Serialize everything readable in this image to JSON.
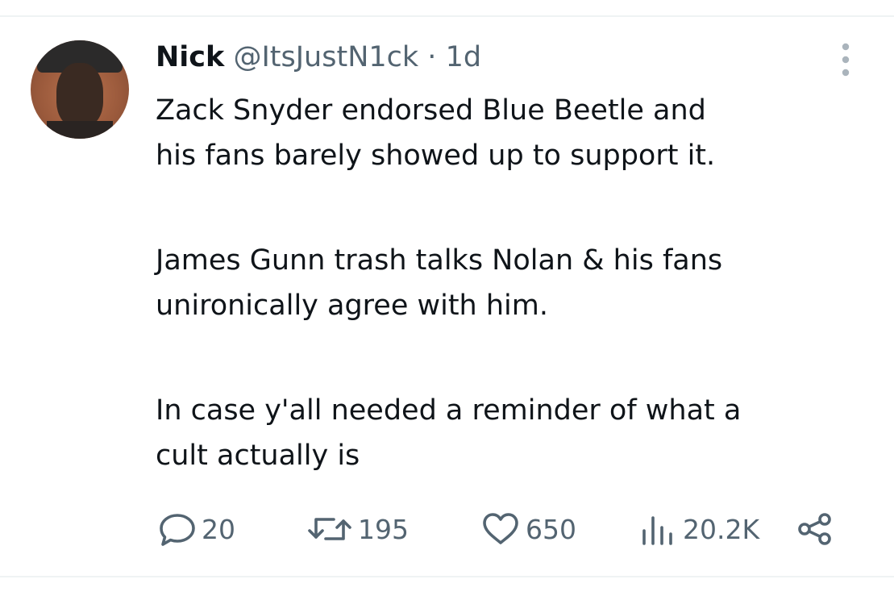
{
  "tweet": {
    "author_name": "Nick",
    "handle": "@ItsJustN1ck",
    "separator": " · ",
    "time": "1d",
    "paragraphs": [
      [
        "Zack Snyder endorsed Blue Beetle and",
        "his fans barely showed up to support it."
      ],
      [
        "James Gunn trash talks Nolan & his fans",
        "unironically agree with him."
      ],
      [
        "In case y'all needed a reminder of what a",
        "cult actually is"
      ]
    ]
  },
  "actions": {
    "replies": "20",
    "retweets": "195",
    "likes": "650",
    "views": "20.2K"
  },
  "icons": {
    "reply": "reply-icon",
    "retweet": "retweet-icon",
    "like": "heart-icon",
    "views": "views-icon",
    "share": "share-icon",
    "more": "more-options-icon"
  },
  "colors": {
    "text": "#0f1419",
    "secondary": "#536471",
    "divider": "#eff3f4"
  }
}
